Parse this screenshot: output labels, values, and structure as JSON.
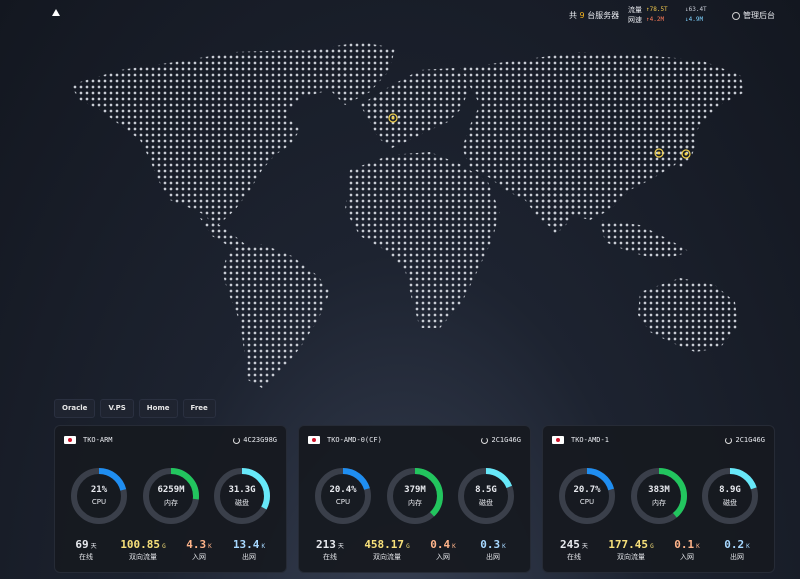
{
  "topbar": {
    "server_count_prefix": "共",
    "server_count": "9",
    "server_count_suffix": "台服务器",
    "traffic_label": "流量",
    "speed_label": "网速",
    "traffic_up": "↑78.5T",
    "traffic_down": "↓63.4T",
    "speed_up": "↑4.2M",
    "speed_down": "↓4.9M",
    "admin_label": "管理后台"
  },
  "tabs": [
    "Oracle",
    "V.PS",
    "Home",
    "Free"
  ],
  "colors": {
    "cpu": "#1f8ef1",
    "mem": "#22c55e",
    "disk": "#67e8f9",
    "ring_bg": "#3a3f4a",
    "marker": "#f2d14c"
  },
  "servers": [
    {
      "name": "TKO-ARM",
      "spec": "4C23G98G",
      "cpu": "21%",
      "cpu_pct": 0.21,
      "mem": "6259M",
      "mem_pct": 0.27,
      "disk": "31.3G",
      "disk_pct": 0.33,
      "uptime": "69",
      "uptime_unit": "天",
      "total": "100.85",
      "total_unit": "G",
      "in": "4.3",
      "in_unit": "K",
      "out": "13.4",
      "out_unit": "K"
    },
    {
      "name": "TKO-AMD-0(CF)",
      "spec": "2C1G46G",
      "cpu": "20.4%",
      "cpu_pct": 0.204,
      "mem": "379M",
      "mem_pct": 0.38,
      "disk": "8.5G",
      "disk_pct": 0.19,
      "uptime": "213",
      "uptime_unit": "天",
      "total": "458.17",
      "total_unit": "G",
      "in": "0.4",
      "in_unit": "K",
      "out": "0.3",
      "out_unit": "K"
    },
    {
      "name": "TKO-AMD-1",
      "spec": "2C1G46G",
      "cpu": "20.7%",
      "cpu_pct": 0.207,
      "mem": "383M",
      "mem_pct": 0.39,
      "disk": "8.9G",
      "disk_pct": 0.2,
      "uptime": "245",
      "uptime_unit": "天",
      "total": "177.45",
      "total_unit": "G",
      "in": "0.1",
      "in_unit": "K",
      "out": "0.2",
      "out_unit": "K"
    }
  ],
  "labels": {
    "cpu": "CPU",
    "mem": "内存",
    "disk": "磁盘",
    "online": "在线",
    "both": "双向流量",
    "in": "入网",
    "out": "出网"
  }
}
